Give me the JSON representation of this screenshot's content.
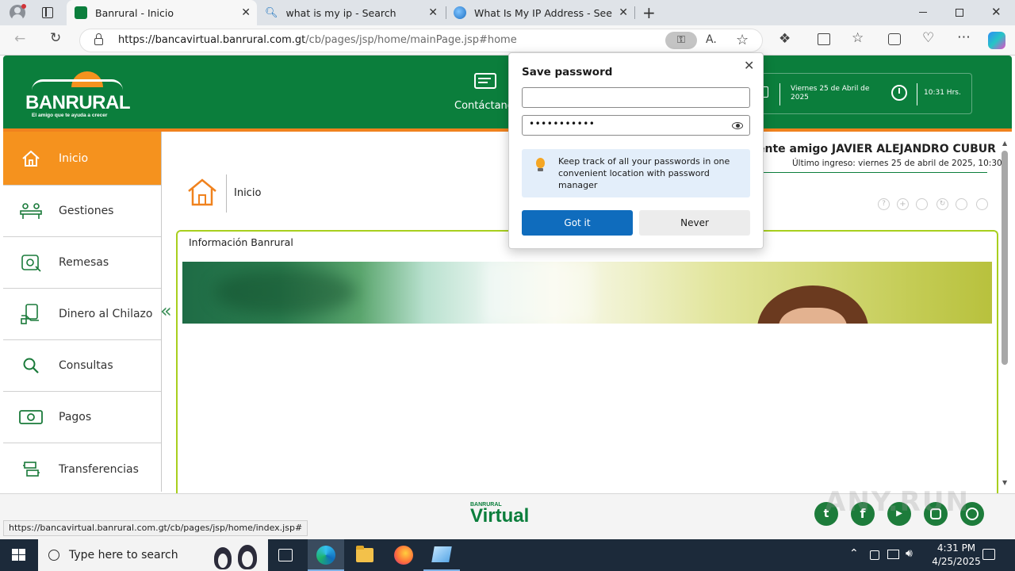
{
  "browser": {
    "tabs": [
      {
        "title": "Banrural - Inicio",
        "active": true
      },
      {
        "title": "what is my ip - Search",
        "active": false
      },
      {
        "title": "What Is My IP Address - See Your",
        "active": false
      }
    ],
    "address": {
      "host": "https://bancavirtual.banrural.com.gt",
      "path": "/cb/pages/jsp/home/mainPage.jsp#home"
    },
    "status_url": "https://bancavirtual.banrural.com.gt/cb/pages/jsp/home/index.jsp#"
  },
  "header": {
    "logo_text": "BANRURAL",
    "logo_tagline": "El amigo que te ayuda a crecer",
    "contact_label": "Contáctanos",
    "date_text": "Viernes 25 de Abril de 2025",
    "time_text": "10:31 Hrs."
  },
  "user": {
    "greeting": "ente amigo JAVIER ALEJANDRO CUBUR",
    "last_login": "Último ingreso: viernes 25 de abril de 2025, 10:30"
  },
  "sidebar": {
    "items": [
      {
        "label": "Inicio",
        "icon": "home-icon",
        "active": true
      },
      {
        "label": "Gestiones",
        "icon": "people-desk-icon",
        "active": false
      },
      {
        "label": "Remesas",
        "icon": "money-bag-icon",
        "active": false
      },
      {
        "label": "Dinero al Chilazo",
        "icon": "cash-hand-icon",
        "active": false
      },
      {
        "label": "Consultas",
        "icon": "search-icon",
        "active": false
      },
      {
        "label": "Pagos",
        "icon": "banknote-icon",
        "active": false
      },
      {
        "label": "Transferencias",
        "icon": "transfer-icon",
        "active": false
      }
    ]
  },
  "content": {
    "breadcrumb": "Inicio",
    "panel_title": "Información Banrural"
  },
  "footer": {
    "brand_small": "BANRURAL",
    "brand_big": "Virtual"
  },
  "dialog": {
    "title": "Save password",
    "username_value": "",
    "password_mask": "•••••••••••",
    "tip": "Keep track of all your passwords in one convenient location with password manager",
    "primary_label": "Got it",
    "secondary_label": "Never"
  },
  "taskbar": {
    "search_placeholder": "Type here to search",
    "time": "4:31 PM",
    "date": "4/25/2025"
  },
  "watermark": "ANY.RUN",
  "colors": {
    "brand_green": "#0b7e3c",
    "brand_orange": "#f5921e",
    "edge_blue": "#0f6cbd",
    "panel_border": "#a8cf1e"
  }
}
